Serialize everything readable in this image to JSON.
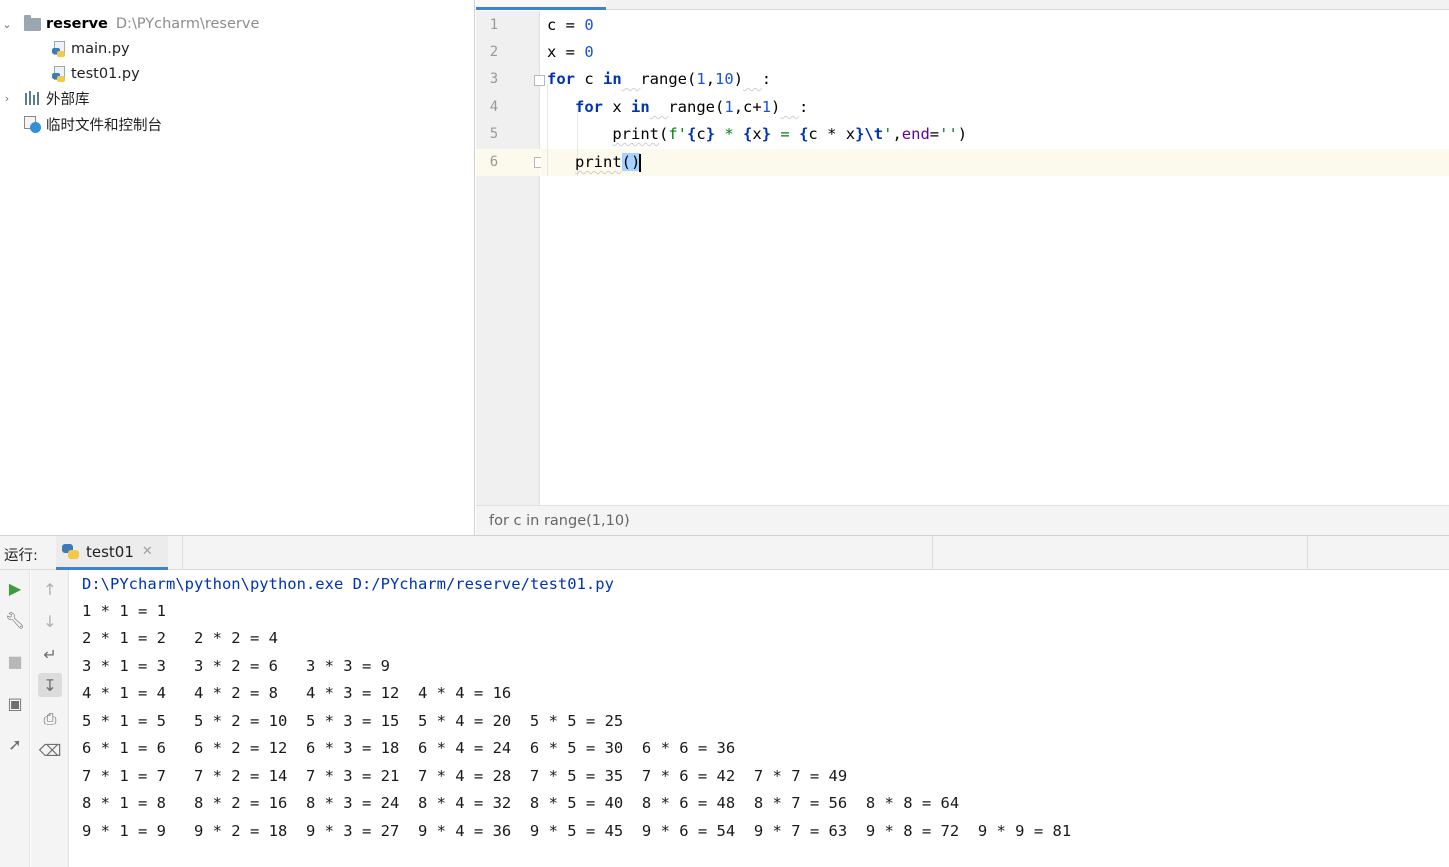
{
  "project": {
    "root_name": "reserve",
    "root_path": "D:\\PYcharm\\reserve",
    "files": [
      "main.py",
      "test01.py"
    ],
    "external_libraries": "外部库",
    "scratches": "临时文件和控制台"
  },
  "editor": {
    "line_numbers": [
      "1",
      "2",
      "3",
      "4",
      "5",
      "6"
    ],
    "breadcrumb": "for c in range(1,10)"
  },
  "run": {
    "label": "运行:",
    "tab_name": "test01",
    "command": "D:\\PYcharm\\python\\python.exe D:/PYcharm/reserve/test01.py",
    "output": [
      "1 * 1 = 1",
      "2 * 1 = 2   2 * 2 = 4",
      "3 * 1 = 3   3 * 2 = 6   3 * 3 = 9",
      "4 * 1 = 4   4 * 2 = 8   4 * 3 = 12  4 * 4 = 16",
      "5 * 1 = 5   5 * 2 = 10  5 * 3 = 15  5 * 4 = 20  5 * 5 = 25",
      "6 * 1 = 6   6 * 2 = 12  6 * 3 = 18  6 * 4 = 24  6 * 5 = 30  6 * 6 = 36",
      "7 * 1 = 7   7 * 2 = 14  7 * 3 = 21  7 * 4 = 28  7 * 5 = 35  7 * 6 = 42  7 * 7 = 49",
      "8 * 1 = 8   8 * 2 = 16  8 * 3 = 24  8 * 4 = 32  8 * 5 = 40  8 * 6 = 48  8 * 7 = 56  8 * 8 = 64",
      "9 * 1 = 9   9 * 2 = 18  9 * 3 = 27  9 * 4 = 36  9 * 5 = 45  9 * 6 = 54  9 * 7 = 63  9 * 8 = 72  9 * 9 = 81"
    ]
  },
  "icons": {
    "run": "play-icon",
    "wrench": "wrench-icon",
    "stop": "stop-icon",
    "layout": "layout-icon",
    "pin": "pin-icon",
    "up": "arrow-up-icon",
    "down": "arrow-down-icon",
    "soft_wrap": "soft-wrap-icon",
    "scroll_end": "scroll-to-end-icon",
    "print": "print-icon",
    "trash": "trash-icon"
  },
  "colors": {
    "keyword": "#0033b3",
    "number": "#1750eb",
    "string": "#067d17",
    "accent": "#4083c9",
    "run_green": "#3e9c3e"
  }
}
